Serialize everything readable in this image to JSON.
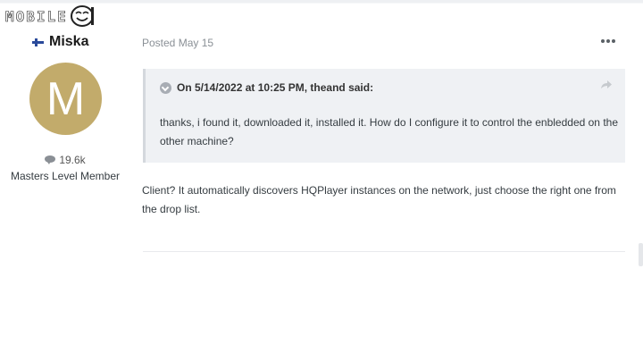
{
  "site": {
    "logo_text": "MOBILE01"
  },
  "author": {
    "name": "Miska",
    "avatar_letter": "M",
    "avatar_color": "#c2ab6b",
    "reputation": "19.6k",
    "member_title": "Masters Level Member",
    "flag_icon": "finland-flag-icon"
  },
  "post": {
    "posted_label": "Posted May 15",
    "quote": {
      "header": "On 5/14/2022 at 10:25 PM, theand said:",
      "body": "thanks, i found it, downloaded it, installed it. How do I configure it to control the enbledded on the other machine?"
    },
    "body": "Client? It automatically discovers HQPlayer instances on the network, just choose the right one from the drop list."
  },
  "colors": {
    "quote_bg": "#eff1f4",
    "muted_text": "#8a9096",
    "body_text": "#353c41"
  }
}
